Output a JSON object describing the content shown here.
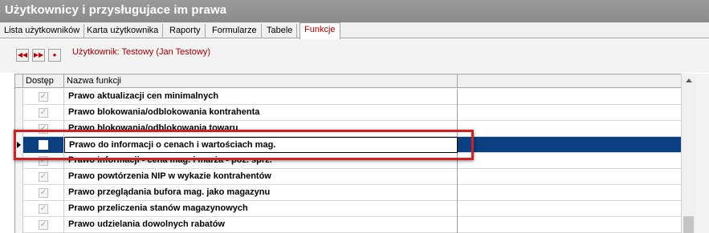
{
  "window": {
    "title": "Użytkownicy i przysługujace im prawa"
  },
  "tabs": [
    {
      "label": "Lista użytkowników",
      "active": false
    },
    {
      "label": "Karta użytkownika",
      "active": false
    },
    {
      "label": "Raporty",
      "active": false
    },
    {
      "label": "Formularze",
      "active": false
    },
    {
      "label": "Tabele",
      "active": false
    },
    {
      "label": "Funkcje",
      "active": true
    }
  ],
  "toolbar": {
    "buttons": [
      {
        "icon": "rewind-icon",
        "glyph": "◀◀"
      },
      {
        "icon": "fast-forward-icon",
        "glyph": "▶▶"
      },
      {
        "icon": "record-icon",
        "glyph": "●"
      }
    ],
    "user_label": "Użytkownik: Testowy  (Jan Testowy)"
  },
  "grid": {
    "columns": [
      "Dostęp",
      "Nazwa funkcji"
    ],
    "rows": [
      {
        "name": "Prawo aktualizacji cen minimalnych",
        "access": true,
        "selected": false
      },
      {
        "name": "Prawo blokowania/odblokowania kontrahenta",
        "access": true,
        "selected": false
      },
      {
        "name": "Prawo blokowania/odblokowania towaru",
        "access": true,
        "selected": false
      },
      {
        "name": "Prawo do informacji o cenach i wartościach mag.",
        "access": false,
        "selected": true
      },
      {
        "name": "Prawo informacji - cena mag. i marża - poz. sprz.",
        "access": true,
        "selected": false
      },
      {
        "name": "Prawo powtórzenia NIP w wykazie kontrahentów",
        "access": true,
        "selected": false
      },
      {
        "name": "Prawo przeglądania bufora mag. jako magazynu",
        "access": true,
        "selected": false
      },
      {
        "name": "Prawo przeliczenia stanów magazynowych",
        "access": true,
        "selected": false
      },
      {
        "name": "Prawo udzielania dowolnych rabatów",
        "access": true,
        "selected": false
      }
    ]
  },
  "colors": {
    "title_bg": "#8c8c8c",
    "selection": "#0a3f82",
    "highlight": "#d21f1f",
    "user_label": "#a00000"
  }
}
